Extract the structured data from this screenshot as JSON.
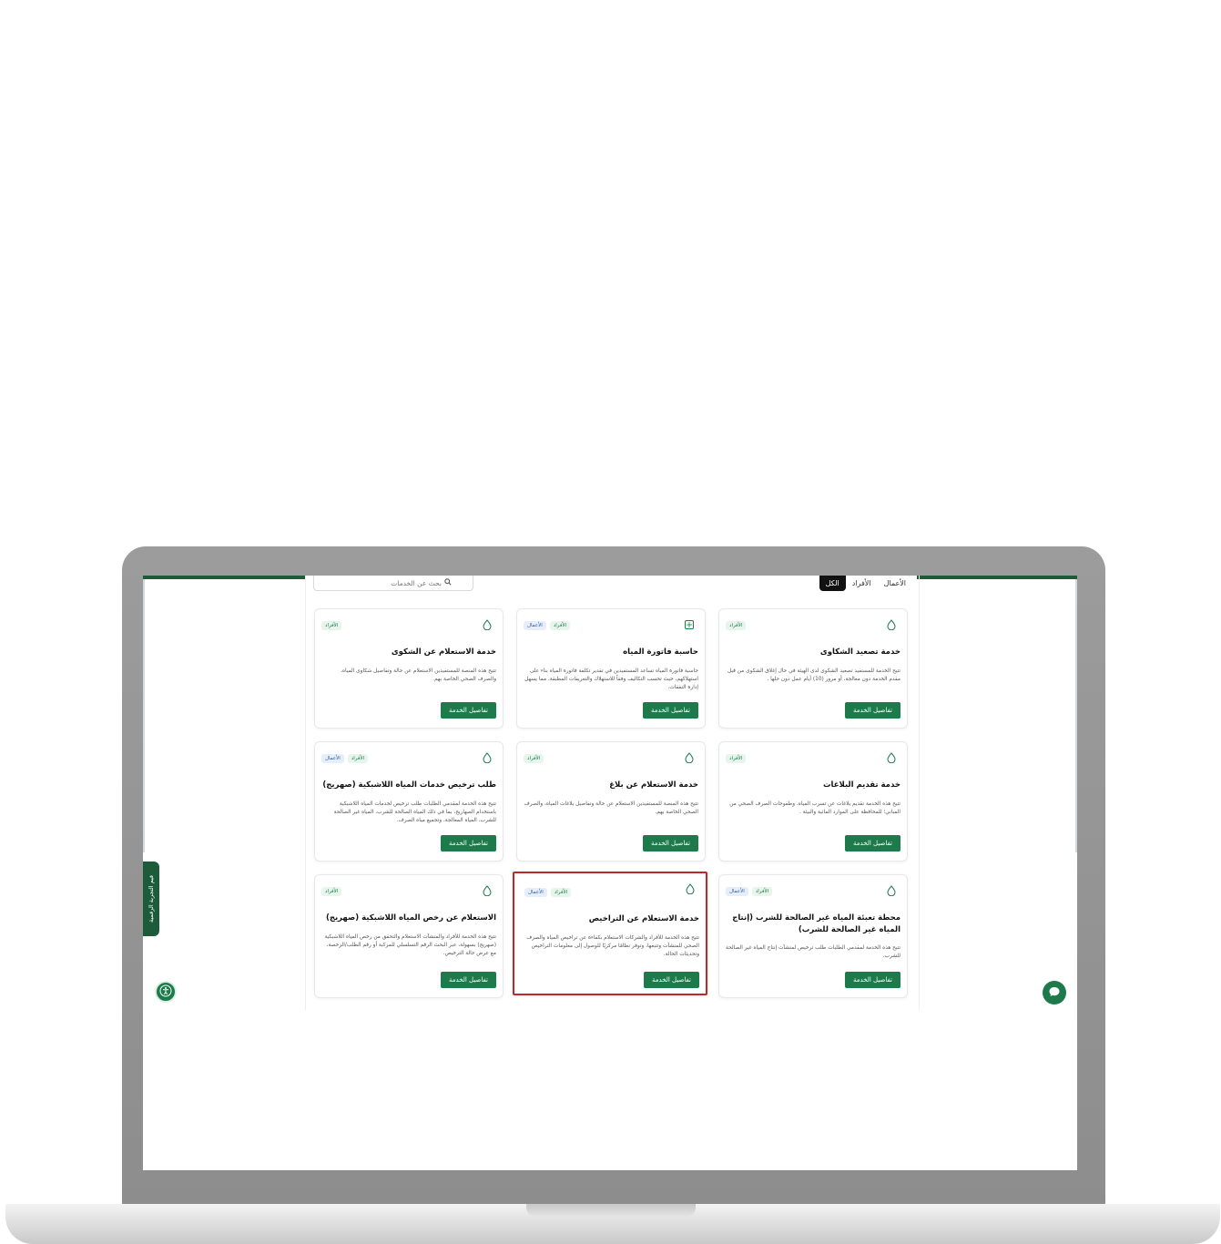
{
  "filters": {
    "all": "الكل",
    "individuals": "الأفراد",
    "business": "الأعمال"
  },
  "search": {
    "placeholder": "بحث عن الخدمات"
  },
  "cards": [
    {
      "title": "خدمة تصعيد الشكاوى",
      "desc": "تتيح الخدمة للمستفيد تصعيد الشكوى لدى الهيئة في حال إغلاق الشكوى من قبل مقدم الخدمة دون معالجة، أو مرور (10) أيام عمل دون حلها .",
      "tags": [
        "الأفراد"
      ],
      "button": "تفاصيل الخدمة",
      "icon": "water-drop-icon"
    },
    {
      "title": "حاسبة فاتورة المياه",
      "desc": "حاسبة فاتورة المياه تساعد المستفيدين في تقدير تكلفة فاتورة المياه بناء على استهلاكهم، حيث تحسب التكاليف وفقاً للاستهلاك والتعريفات المطبقة، مما يسهل إدارة النفقات.",
      "tags": [
        "الأفراد",
        "الأعمال"
      ],
      "button": "تفاصيل الخدمة",
      "icon": "calculator-icon"
    },
    {
      "title": "خدمة الاستعلام عن الشكوى",
      "desc": "تتيح هذه المنصة للمستفيدين الاستعلام عن حالة وتفاصيل شكاوى المياه، والصرف الصحي الخاصة بهم.",
      "tags": [
        "الأفراد"
      ],
      "button": "تفاصيل الخدمة",
      "icon": "water-drop-icon"
    },
    {
      "title": "خدمة تقديم البلاغات",
      "desc": "تتيح هذه الخدمة تقديم بلاغات عن تسرب المياه، وطفوحات الصرف الصحي من المباني؛ للمحافظة على الموارد المائية والبيئة .",
      "tags": [
        "الأفراد"
      ],
      "button": "تفاصيل الخدمة",
      "icon": "water-drop-icon"
    },
    {
      "title": "خدمة الاستعلام عن بلاغ",
      "desc": "تتيح هذه المنصة للمستفيدين الاستعلام عن حالة وتفاصيل بلاغات المياه، والصرف الصحي الخاصة بهم.",
      "tags": [
        "الأفراد"
      ],
      "button": "تفاصيل الخدمة",
      "icon": "water-drop-icon"
    },
    {
      "title": "طلب ترخيص خدمات المياه اللاشبكية (صهريج)",
      "desc": "تتيح هذه الخدمة لمقدمي الطلبات طلب ترخيص لخدمات المياه اللاشبكية باستخدام الصهاريج، بما في ذلك المياه الصالحة للشرب، المياه غير الصالحة للشرب، المياه المعالجة، وتجميع مياه الصرف.",
      "tags": [
        "الأفراد",
        "الأعمال"
      ],
      "button": "تفاصيل الخدمة",
      "icon": "water-drop-icon"
    },
    {
      "title": "محطة تعبئة المياه غير الصالحة للشرب (إنتاج المياه غير الصالحة للشرب)",
      "desc": "تتيح هذه الخدمة لمقدمي الطلبات طلب ترخيص لمنشآت إنتاج المياه غير الصالحة للشرب.",
      "tags": [
        "الأفراد",
        "الأعمال"
      ],
      "button": "تفاصيل الخدمة",
      "icon": "water-drop-icon"
    },
    {
      "title": "خدمة الاستعلام عن التراخيص",
      "desc": "تتيح هذه الخدمة للأفراد والشركات الاستعلام بكفاءة عن تراخيص المياه والصرف الصحي للمنشآت وتتبعها، وتوفر نظامًا مركزيًا للوصول إلى معلومات التراخيص وتحديثات الحالة.",
      "tags": [
        "الأفراد",
        "الأعمال"
      ],
      "button": "تفاصيل الخدمة",
      "icon": "water-drop-icon"
    },
    {
      "title": "الاستعلام عن رخص المياه اللاشبكية (صهريج)",
      "desc": "تتيح هذه الخدمة للأفراد والمنشآت الاستعلام والتحقق من رخص المياه اللاشبكية (صهريج) بسهولة، عبر البحث الرقم التسلسلي للمركبة أو رقم الطلب/الرخصة، مع عرض حالة الترخيص.",
      "tags": [
        "الأفراد"
      ],
      "button": "تفاصيل الخدمة",
      "icon": "water-drop-icon"
    }
  ],
  "side_tab": "قيم التجربة الرقمية",
  "colors": {
    "brand_green": "#1d7a4a",
    "dark_green": "#1d5c3b",
    "highlight_red": "#c0272d"
  }
}
